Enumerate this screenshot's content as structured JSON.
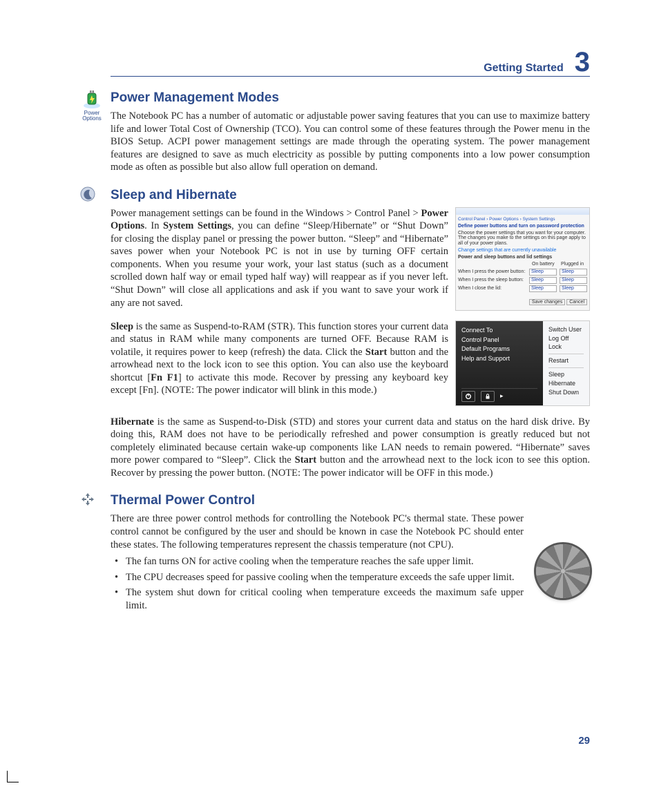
{
  "header": {
    "chapter_label": "Getting Started",
    "chapter_number": "3"
  },
  "page_number": "29",
  "power_management": {
    "title": "Power Management Modes",
    "icon_name": "power-options-icon",
    "icon_caption": "Power Options",
    "body_html": "The Notebook PC has a number of automatic or adjustable power saving features that you can use to maximize battery life and lower Total Cost of Ownership (TCO). You can control some of these features through the Power menu in the BIOS Setup. ACPI power management settings are made through the operating system. The power management features are designed to save as much electricity as possible by putting components into a low power consumption mode as often as possible but also allow full operation on demand."
  },
  "sleep_hibernate": {
    "title": "Sleep and Hibernate",
    "icon_name": "moon-icon",
    "para1_html": "Power management settings can be found in the Windows &gt; Control Panel &gt; <b>Power Options</b>. In <b>System Settings</b>, you can define &ldquo;Sleep/Hibernate&rdquo; or &ldquo;Shut Down&rdquo; for closing the display panel or pressing the power button. &ldquo;Sleep&rdquo; and &ldquo;Hibernate&rdquo; saves power when your Notebook PC is not in use by turning OFF certain components. When you resume your work, your last status (such as a document scrolled down half way or email typed half way) will reappear as if you never left. &ldquo;Shut Down&rdquo; will close all applications and ask if you want to save your work if any are not saved.",
    "para2_html": "<b>Sleep</b> is the same as Suspend-to-RAM (STR). This function stores your current data and status in RAM while many components are turned OFF. Because RAM is volatile, it requires power to keep (refresh) the data. Click the <b>Start</b> button and the arrowhead next to the lock icon to see this option. You can also use the keyboard shortcut [<b>Fn F1</b>] to activate this mode. Recover by pressing any keyboard key except [Fn]. (NOTE: The power indicator will blink in this mode.)",
    "para3_html": "<b>Hibernate</b> is the same as  Suspend-to-Disk (STD) and stores your current data and status on the hard disk drive. By doing this, RAM does not have to be periodically refreshed and power consumption is greatly reduced but not completely eliminated because certain wake-up components like LAN needs to remain powered. &ldquo;Hibernate&rdquo; saves more power compared to &ldquo;Sleep&rdquo;. Click the <b>Start</b> button and the arrowhead next to the lock icon to see this option. Recover by pressing the power button. (NOTE: The power indicator will be OFF in this mode.)",
    "fig_power_options": {
      "breadcrumb": "Control Panel › Power Options › System Settings",
      "heading": "Define power buttons and turn on password protection",
      "sub": "Choose the power settings that you want for your computer. The changes you make to the settings on this page apply to all of your power plans.",
      "change_link": "Change settings that are currently unavailable",
      "group": "Power and sleep buttons and lid settings",
      "col_battery": "On battery",
      "col_plugged": "Plugged in",
      "row1": "When I press the power button:",
      "row2": "When I press the sleep button:",
      "row3": "When I close the lid:",
      "combo_value": "Sleep",
      "btn_save": "Save changes",
      "btn_cancel": "Cancel"
    },
    "fig_start_menu": {
      "left_items": [
        "Connect To",
        "Control Panel",
        "Default Programs",
        "Help and Support"
      ],
      "right_items_top": [
        "Switch User",
        "Log Off",
        "Lock"
      ],
      "right_items_mid": [
        "Restart"
      ],
      "right_items_bot": [
        "Sleep",
        "Hibernate",
        "Shut Down"
      ]
    }
  },
  "thermal": {
    "title": "Thermal Power Control",
    "icon_name": "arrows-icon",
    "intro": "There are three power control methods for controlling the Notebook PC's thermal state. These power control cannot be configured by the user and should be known in case the Notebook PC should enter these states. The following temperatures represent the chassis temperature (not CPU).",
    "bullets": [
      "The fan turns ON for active cooling when the temperature reaches the safe upper limit.",
      "The CPU decreases speed for passive cooling when the temperature exceeds the safe upper limit.",
      "The system shut down for critical cooling when temperature exceeds the maximum safe upper limit."
    ]
  }
}
